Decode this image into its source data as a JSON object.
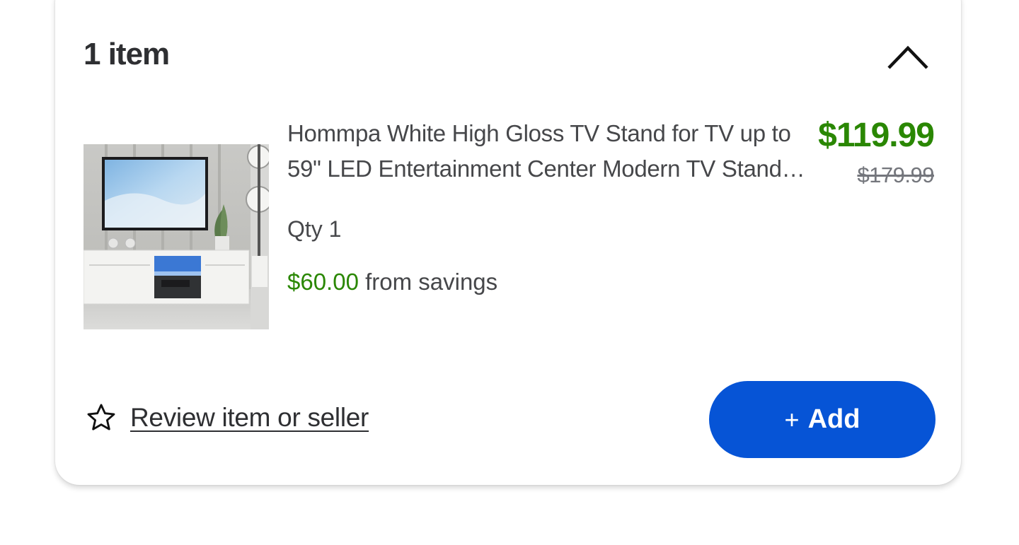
{
  "order": {
    "item_count_label": "1 item"
  },
  "product": {
    "title": "Hommpa White High Gloss TV Stand for TV up to 59\" LED Entertainment Center Modern TV Stand with Storage",
    "price_current": "$119.99",
    "price_original": "$179.99",
    "qty_label": "Qty 1",
    "savings_amount": "$60.00",
    "savings_suffix": " from savings",
    "image_icon": "product-thumbnail"
  },
  "actions": {
    "review_label": "Review item or seller",
    "review_icon": "star-outline-icon",
    "add_plus": "+",
    "add_label": "Add",
    "collapse_icon": "chevron-up-icon"
  },
  "colors": {
    "accent_blue": "#0654d6",
    "price_green": "#2a8703",
    "text_dark": "#2e2f32",
    "text_muted": "#74767c"
  }
}
